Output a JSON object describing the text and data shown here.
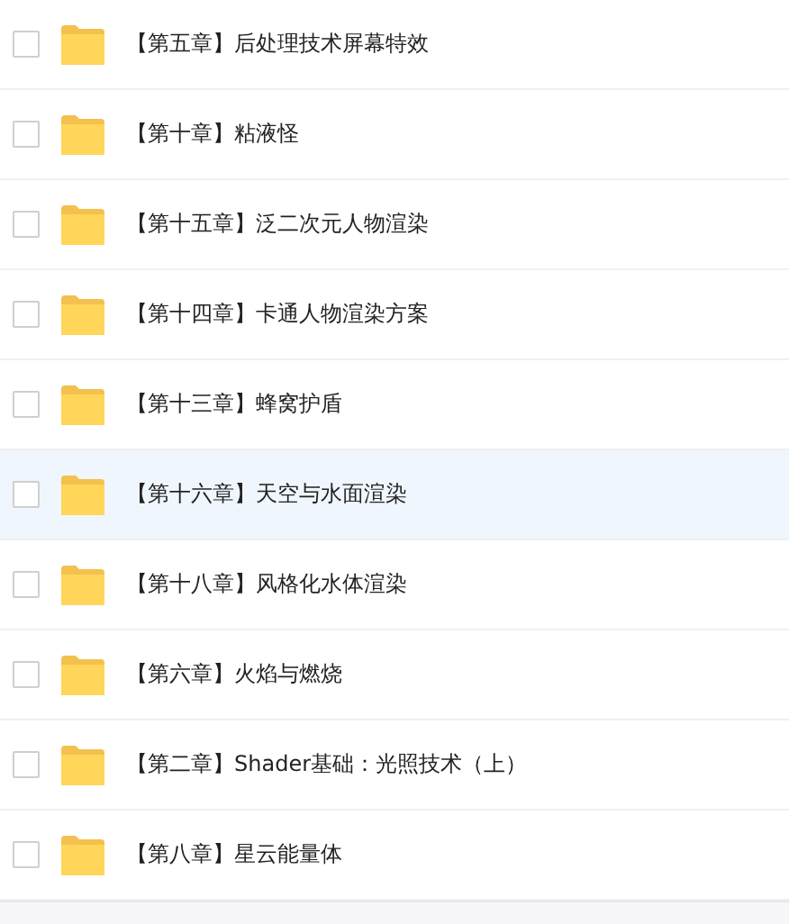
{
  "files": [
    {
      "name": "【第五章】后处理技术屏幕特效",
      "checked": false,
      "highlighted": false
    },
    {
      "name": "【第十章】粘液怪",
      "checked": false,
      "highlighted": false
    },
    {
      "name": "【第十五章】泛二次元人物渲染",
      "checked": false,
      "highlighted": false
    },
    {
      "name": "【第十四章】卡通人物渲染方案",
      "checked": false,
      "highlighted": false
    },
    {
      "name": "【第十三章】蜂窝护盾",
      "checked": false,
      "highlighted": false
    },
    {
      "name": "【第十六章】天空与水面渲染",
      "checked": false,
      "highlighted": true
    },
    {
      "name": "【第十八章】风格化水体渲染",
      "checked": false,
      "highlighted": false
    },
    {
      "name": "【第六章】火焰与燃烧",
      "checked": false,
      "highlighted": false
    },
    {
      "name": "【第二章】Shader基础：光照技术（上）",
      "checked": false,
      "highlighted": false
    },
    {
      "name": "【第八章】星云能量体",
      "checked": false,
      "highlighted": false
    }
  ]
}
